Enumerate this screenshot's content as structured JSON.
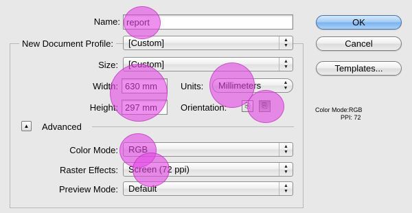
{
  "dialog": {
    "name_label": "Name:",
    "name_value": "report",
    "profile_label": "New Document Profile:",
    "profile_value": "[Custom]",
    "size_label": "Size:",
    "size_value": "[Custom]",
    "width_label": "Width:",
    "width_value": "630 mm",
    "height_label": "Height:",
    "height_value": "297 mm",
    "units_label": "Units:",
    "units_value": "Millimeters",
    "orientation_label": "Orientation:",
    "advanced_label": "Advanced",
    "color_mode_label": "Color Mode:",
    "color_mode_value": "RGB",
    "raster_label": "Raster Effects:",
    "raster_value": "Screen (72 ppi)",
    "preview_label": "Preview Mode:",
    "preview_value": "Default"
  },
  "buttons": {
    "ok": "OK",
    "cancel": "Cancel",
    "templates": "Templates..."
  },
  "info": {
    "color_mode_line": "Color Mode:RGB",
    "ppi_line": "PPI: 72"
  },
  "icons": {
    "select_arrows": "▲▼",
    "disclosure": "▲",
    "portrait": "portrait-orientation-icon",
    "landscape": "landscape-orientation-icon"
  },
  "colors": {
    "background": "#e8e8e8",
    "ok_button": "#a3cbf4",
    "highlight_marker": "#e246e2"
  }
}
